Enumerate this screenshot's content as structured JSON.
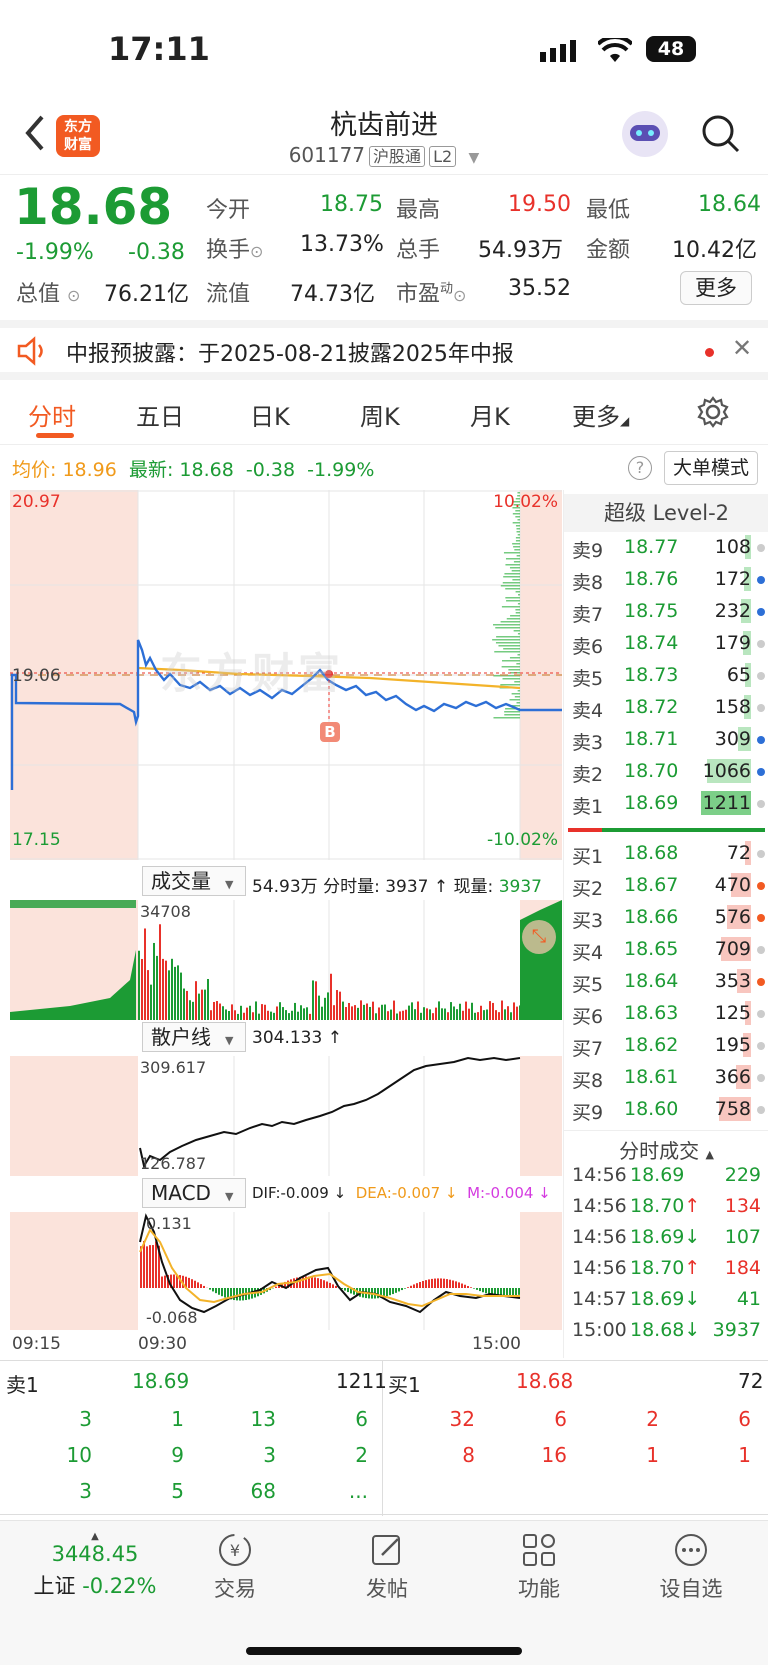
{
  "status": {
    "time": "17:11",
    "battery": "48"
  },
  "header": {
    "logo_text": "东方财富",
    "title": "杭齿前进",
    "code": "601177",
    "tag1": "沪股通",
    "tag2": "L2"
  },
  "quote": {
    "price": "18.68",
    "change_pct": "-1.99%",
    "change": "-0.38",
    "open_label": "今开",
    "open": "18.75",
    "high_label": "最高",
    "high": "19.50",
    "low_label": "最低",
    "low": "18.64",
    "turnover_label": "换手",
    "turnover": "13.73%",
    "volume_label": "总手",
    "volume": "54.93万",
    "amount_label": "金额",
    "amount": "10.42亿",
    "mktcap_label": "总值",
    "mktcap": "76.21亿",
    "float_label": "流值",
    "float": "74.73亿",
    "pe_label": "市盈",
    "pe_sup": "动",
    "pe": "35.52",
    "more_label": "更多"
  },
  "notice": {
    "text": "中报预披露：于2025-08-21披露2025年中报"
  },
  "tabs": [
    "分时",
    "五日",
    "日K",
    "周K",
    "月K",
    "更多"
  ],
  "summary": {
    "avg_label": "均价:",
    "avg": "18.96",
    "latest_label": "最新:",
    "latest": "18.68",
    "chg": "-0.38",
    "pct": "-1.99%",
    "mode_label": "大单模式"
  },
  "main_chart": {
    "y_top": "20.97",
    "y_mid": "19.06",
    "y_bot": "17.15",
    "pct_top": "10.02%",
    "pct_bot": "-10.02%",
    "marker": "B",
    "watermark": "东方财富"
  },
  "volume_panel": {
    "label": "成交量",
    "total": "54.93万",
    "min_label": "分时量:",
    "min_vol": "3937 ↑",
    "now_label": "现量:",
    "now_vol": "3937",
    "max": "34708"
  },
  "retail_panel": {
    "label": "散户线",
    "value": "304.133 ↑",
    "max": "309.617",
    "min": "126.787"
  },
  "macd_panel": {
    "label": "MACD",
    "dif": "DIF:-0.009 ↓",
    "dea": "DEA:-0.007 ↓",
    "m": "M:-0.004 ↓",
    "max": "0.131",
    "min": "-0.068"
  },
  "time_axis": [
    "09:15",
    "09:30",
    "15:00"
  ],
  "level2": {
    "title": "超级 Level-2",
    "asks": [
      {
        "label": "卖9",
        "price": "18.77",
        "vol": "108",
        "w": 0.09,
        "dot": "#ccc"
      },
      {
        "label": "卖8",
        "price": "18.76",
        "vol": "172",
        "w": 0.14,
        "dot": "#2d6fd6"
      },
      {
        "label": "卖7",
        "price": "18.75",
        "vol": "232",
        "w": 0.19,
        "dot": "#2d6fd6"
      },
      {
        "label": "卖6",
        "price": "18.74",
        "vol": "179",
        "w": 0.15,
        "dot": "#ccc"
      },
      {
        "label": "卖5",
        "price": "18.73",
        "vol": "65",
        "w": 0.06,
        "dot": "#ccc"
      },
      {
        "label": "卖4",
        "price": "18.72",
        "vol": "158",
        "w": 0.13,
        "dot": "#ccc"
      },
      {
        "label": "卖3",
        "price": "18.71",
        "vol": "309",
        "w": 0.26,
        "dot": "#2d6fd6"
      },
      {
        "label": "卖2",
        "price": "18.70",
        "vol": "1066",
        "w": 0.88,
        "dot": "#2d6fd6"
      },
      {
        "label": "卖1",
        "price": "18.69",
        "vol": "1211",
        "w": 1.0,
        "dot": "#ccc"
      }
    ],
    "bids": [
      {
        "label": "买1",
        "price": "18.68",
        "vol": "72",
        "w": 0.06,
        "dot": "#ccc"
      },
      {
        "label": "买2",
        "price": "18.67",
        "vol": "470",
        "w": 0.39,
        "dot": "#f25a22"
      },
      {
        "label": "买3",
        "price": "18.66",
        "vol": "576",
        "w": 0.48,
        "dot": "#f25a22"
      },
      {
        "label": "买4",
        "price": "18.65",
        "vol": "709",
        "w": 0.59,
        "dot": "#ccc"
      },
      {
        "label": "买5",
        "price": "18.64",
        "vol": "353",
        "w": 0.29,
        "dot": "#f25a22"
      },
      {
        "label": "买6",
        "price": "18.63",
        "vol": "125",
        "w": 0.1,
        "dot": "#ccc"
      },
      {
        "label": "买7",
        "price": "18.62",
        "vol": "195",
        "w": 0.16,
        "dot": "#ccc"
      },
      {
        "label": "买8",
        "price": "18.61",
        "vol": "366",
        "w": 0.3,
        "dot": "#ccc"
      },
      {
        "label": "买9",
        "price": "18.60",
        "vol": "758",
        "w": 0.63,
        "dot": "#ccc"
      }
    ],
    "ticks_title": "分时成交",
    "ticks": [
      {
        "t": "14:56",
        "p": "18.69",
        "a": "",
        "v": "229",
        "pc": "green",
        "vc": "green"
      },
      {
        "t": "14:56",
        "p": "18.70↑",
        "a": "",
        "v": "134",
        "pc": "green",
        "vc": "red"
      },
      {
        "t": "14:56",
        "p": "18.69↓",
        "a": "",
        "v": "107",
        "pc": "green",
        "vc": "green"
      },
      {
        "t": "14:56",
        "p": "18.70↑",
        "a": "",
        "v": "184",
        "pc": "green",
        "vc": "red"
      },
      {
        "t": "14:57",
        "p": "18.69↓",
        "a": "",
        "v": "41",
        "pc": "green",
        "vc": "green"
      },
      {
        "t": "15:00",
        "p": "18.68↓",
        "a": "",
        "v": "3937",
        "pc": "green",
        "vc": "green"
      }
    ]
  },
  "queue": {
    "sell_label": "卖1",
    "sell_price": "18.69",
    "sell_total": "1211",
    "buy_label": "买1",
    "buy_price": "18.68",
    "buy_total": "72",
    "sell_orders": [
      "3",
      "1",
      "13",
      "6",
      "10",
      "9",
      "3",
      "2",
      "3",
      "5",
      "68",
      "..."
    ],
    "buy_orders": [
      "32",
      "6",
      "2",
      "6",
      "8",
      "16",
      "1",
      "1"
    ]
  },
  "bottom_nav": {
    "index_value": "3448.45",
    "index_name": "上证",
    "index_chg": "-0.22%",
    "items": [
      "交易",
      "发帖",
      "功能",
      "设自选"
    ]
  }
}
